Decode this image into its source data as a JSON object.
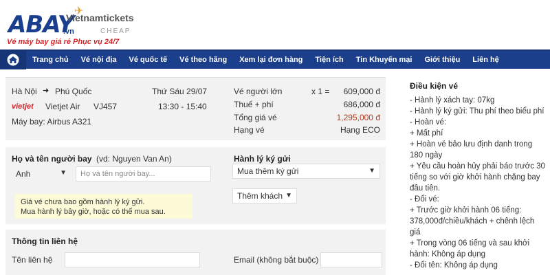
{
  "header": {
    "logo_main": "ABAY",
    "logo_vn": ".vn",
    "logo_sub": "Vietnamtickets",
    "logo_cheap": "CHEAP",
    "tagline": "Vé máy bay giá rẻ Phục vụ 24/7"
  },
  "nav": {
    "items": [
      "Trang chủ",
      "Vé nội địa",
      "Vé quốc tế",
      "Vé theo hãng",
      "Xem lại đơn hàng",
      "Tiện ích",
      "Tin Khuyến mại",
      "Giới thiệu",
      "Liên hệ"
    ]
  },
  "flight": {
    "from": "Hà Nội",
    "to": "Phú Quốc",
    "date": "Thứ Sáu 29/07",
    "airline_logo": "vietjet",
    "airline": "Vietjet Air",
    "flight_no": "VJ457",
    "time": "13:30 - 15:40",
    "aircraft": "Máy bay: Airbus A321"
  },
  "fare": {
    "adult_label": "Vé người lớn",
    "qty": "x 1 =",
    "adult_price": "609,000 đ",
    "tax_label": "Thuế + phí",
    "tax_price": "686,000 đ",
    "total_label": "Tổng giá vé",
    "total_price": "1,295,000 đ",
    "class_label": "Hạng vé",
    "class_value": "Hạng ECO"
  },
  "passenger": {
    "name_label": "Họ và tên người bay",
    "name_hint": "(vd: Nguyen Van An)",
    "title_value": "Anh",
    "name_placeholder": "Họ và tên người bay...",
    "baggage_label": "Hành lý ký gửi",
    "baggage_value": "Mua thêm ký gửi",
    "note_line1": "Giá vé chưa bao gồm hành lý ký gửi.",
    "note_line2": "Mua hành lý bây giờ, hoặc có thể mua sau.",
    "add_pax": "Thêm khách"
  },
  "contact": {
    "title": "Thông tin liên hệ",
    "name_label": "Tên liên hệ",
    "email_label": "Email (không bắt buộc)"
  },
  "conditions": {
    "title": "Điều kiện vé",
    "lines": [
      "- Hành lý xách tay: 07kg",
      "- Hành lý ký gửi: Thu phí theo biểu phí",
      "- Hoàn vé:",
      "+ Mất phí",
      "+ Hoàn vé bảo lưu định danh trong",
      "180 ngày",
      "+ Yêu cầu hoàn hủy phải báo trước 30",
      "tiếng so với giờ khởi hành chặng bay",
      "đầu tiên.",
      "- Đổi vé:",
      "+ Trước giờ khởi hành 06 tiếng:",
      "378,000đ/chiều/khách + chênh lệch",
      "giá",
      "+ Trong vòng 06 tiếng và sau khởi",
      "hành: Không áp dụng",
      "- Đổi tên: Không áp dụng"
    ]
  },
  "colors": {
    "nav": "#1c3f8b",
    "price_total": "#b03a1e",
    "note_bg": "#fcfad7",
    "brand_red": "#d01f26"
  }
}
